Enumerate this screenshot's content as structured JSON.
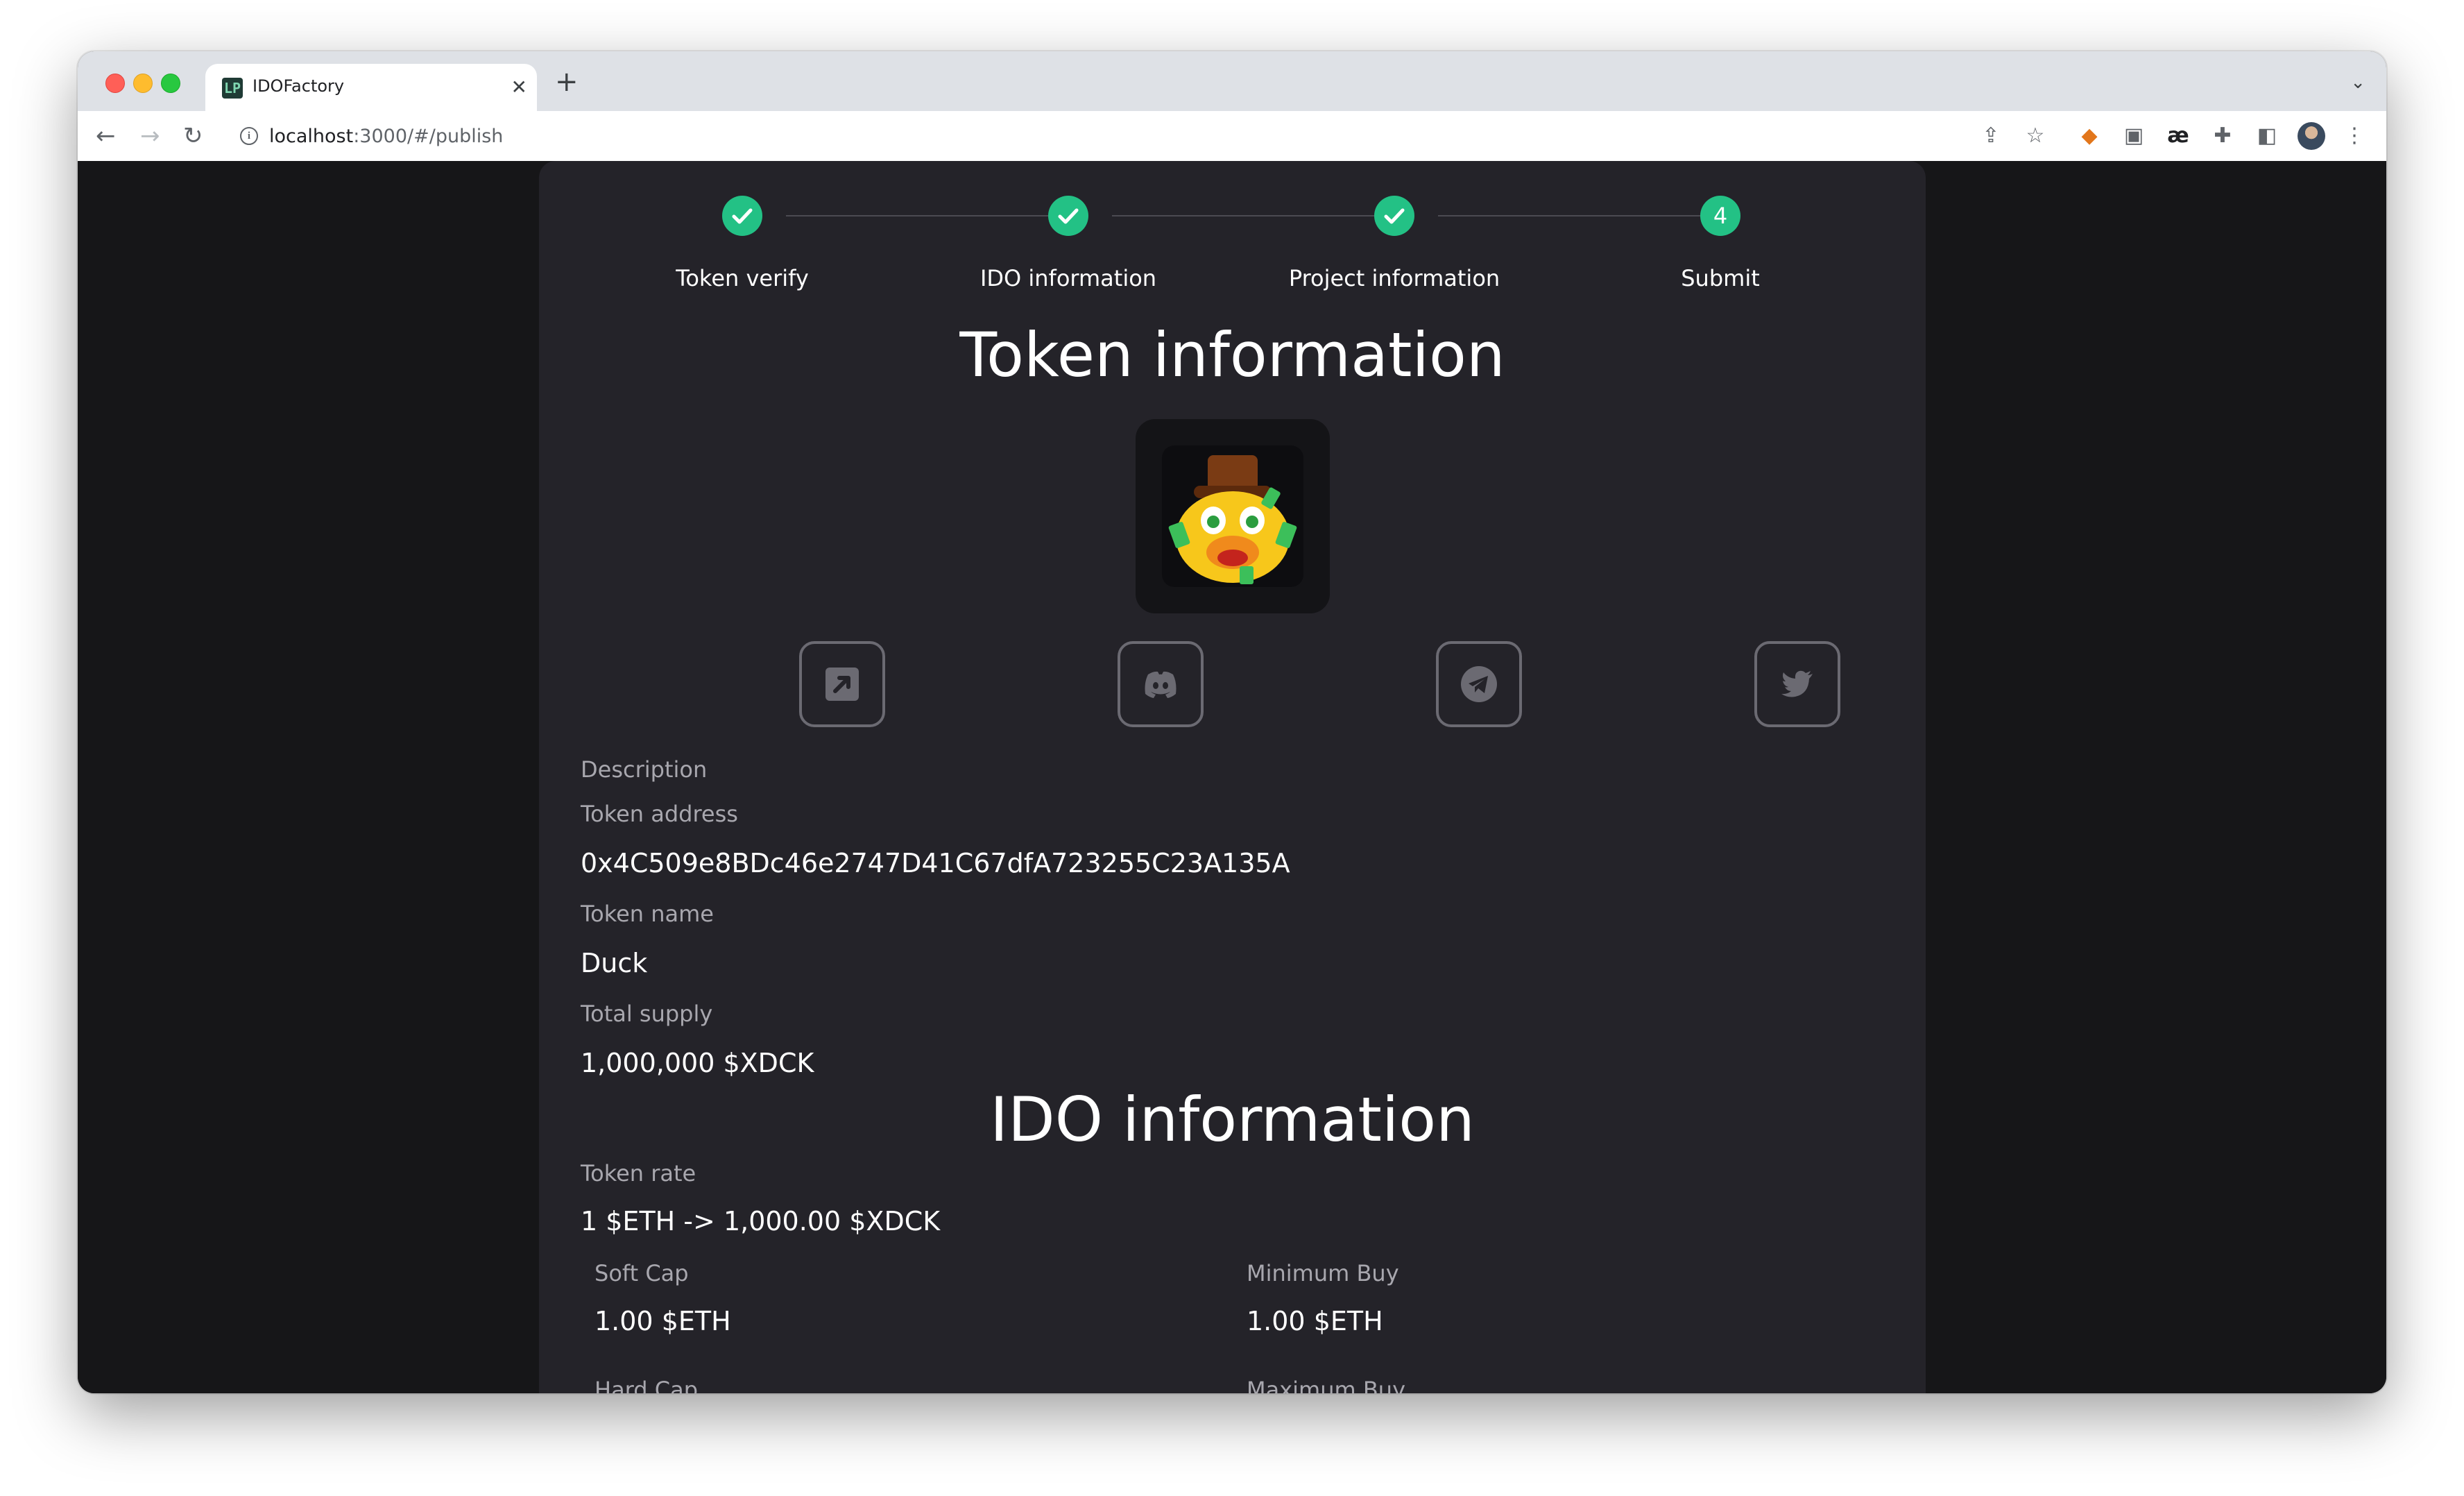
{
  "browser": {
    "tab_title": "IDOFactory",
    "favicon_text": "LP",
    "url_host": "localhost",
    "url_rest": ":3000/#/publish"
  },
  "steps": [
    {
      "label": "Token verify",
      "state": "done"
    },
    {
      "label": "IDO information",
      "state": "done"
    },
    {
      "label": "Project information",
      "state": "done"
    },
    {
      "label": "Submit",
      "number": "4",
      "state": "current"
    }
  ],
  "token_section": {
    "heading": "Token information",
    "description_label": "Description",
    "address_label": "Token address",
    "address_value": "0x4C509e8BDc46e2747D41C67dfA723255C23A135A",
    "name_label": "Token name",
    "name_value": "Duck",
    "supply_label": "Total supply",
    "supply_value": "1,000,000 $XDCK"
  },
  "social_links": [
    {
      "icon": "external-link-icon"
    },
    {
      "icon": "discord-icon"
    },
    {
      "icon": "telegram-icon"
    },
    {
      "icon": "twitter-icon"
    }
  ],
  "ido_section": {
    "heading": "IDO information",
    "rate_label": "Token rate",
    "rate_value": "1 $ETH -> 1,000.00 $XDCK",
    "soft_cap_label": "Soft Cap",
    "soft_cap_value": "1.00 $ETH",
    "min_buy_label": "Minimum Buy",
    "min_buy_value": "1.00 $ETH",
    "hard_cap_label": "Hard Cap",
    "max_buy_label": "Maximum Buy"
  },
  "colors": {
    "accent": "#23c185",
    "card": "#242329",
    "page_bg": "#161618"
  }
}
